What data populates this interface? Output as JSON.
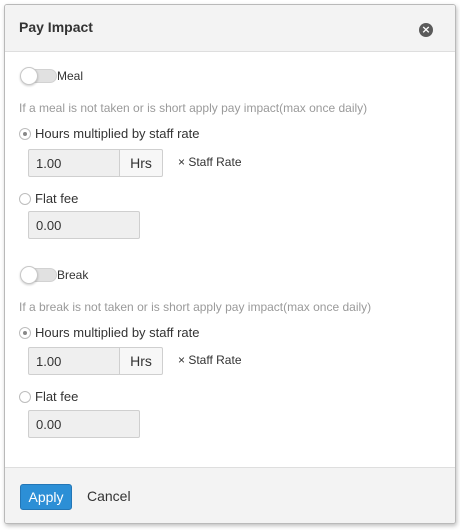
{
  "dialog": {
    "title": "Pay Impact",
    "close_icon": "×"
  },
  "meal": {
    "toggle_label": "Meal",
    "toggle_on": false,
    "description": "If a meal is not taken or is short apply pay impact(max once daily)",
    "option_hours_label": "Hours multiplied by staff rate",
    "option_hours_selected": true,
    "hours_value": "1.00",
    "hours_unit": "Hrs",
    "hours_suffix": "× Staff Rate",
    "option_flat_label": "Flat fee",
    "option_flat_selected": false,
    "flat_value": "0.00"
  },
  "break": {
    "toggle_label": "Break",
    "toggle_on": false,
    "description": "If a break is not taken or is short apply pay impact(max once daily)",
    "option_hours_label": "Hours multiplied by staff rate",
    "option_hours_selected": true,
    "hours_value": "1.00",
    "hours_unit": "Hrs",
    "hours_suffix": "× Staff Rate",
    "option_flat_label": "Flat fee",
    "option_flat_selected": false,
    "flat_value": "0.00"
  },
  "footer": {
    "apply_label": "Apply",
    "cancel_label": "Cancel"
  },
  "colors": {
    "primary": "#2c8fd6",
    "header_bg": "#f3f3f3",
    "muted_text": "#9a9a9a"
  }
}
